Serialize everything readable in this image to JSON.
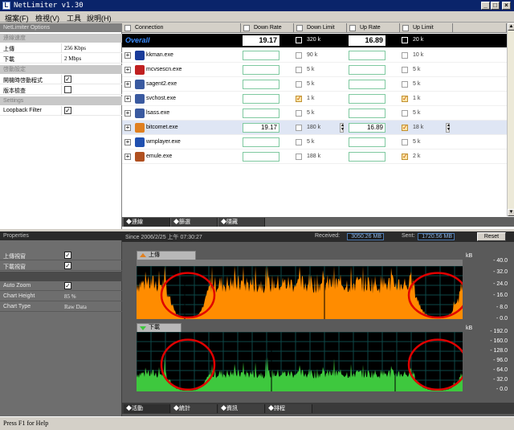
{
  "window": {
    "title": "NetLimiter v1.30",
    "controls": [
      "_",
      "□",
      "×"
    ]
  },
  "menu": [
    "檔案(F)",
    "檢視(V)",
    "工具",
    "說明(H)"
  ],
  "options": {
    "header": "NetLimiter Options",
    "sections": [
      {
        "title": "連線速度",
        "rows": [
          {
            "key": "上傳",
            "value": "256 Kbps"
          },
          {
            "key": "下載",
            "value": "2 Mbps"
          }
        ]
      },
      {
        "title": "啓動設定",
        "rows": [
          {
            "key": "開機時啓動程式",
            "checked": true
          },
          {
            "key": "版本檢查",
            "checked": false
          }
        ]
      },
      {
        "title": "Settings",
        "rows": [
          {
            "key": "Loopback Filter",
            "checked": true
          }
        ]
      }
    ]
  },
  "table": {
    "columns": [
      "Connection",
      "Down Rate",
      "Down Limit",
      "Up Rate",
      "Up Limit"
    ],
    "overall": {
      "name": "Overall",
      "down_rate": "19.17",
      "down_limit": "320 k",
      "up_rate": "16.89",
      "up_limit": "20 k"
    },
    "rows": [
      {
        "name": "kkman.exe",
        "down_rate": "",
        "down_limit": "90 k",
        "down_checked": false,
        "up_rate": "",
        "up_limit": "10 k",
        "up_checked": false,
        "icon": "kkman-icon",
        "color": "#1a3c9a"
      },
      {
        "name": "mcvsescn.exe",
        "down_rate": "",
        "down_limit": "5 k",
        "down_checked": false,
        "up_rate": "",
        "up_limit": "5 k",
        "up_checked": false,
        "icon": "mcafee-icon",
        "color": "#c02020"
      },
      {
        "name": "sagent2.exe",
        "down_rate": "",
        "down_limit": "5 k",
        "down_checked": false,
        "up_rate": "",
        "up_limit": "5 k",
        "up_checked": false,
        "icon": "window-icon",
        "color": "#3a5aa0"
      },
      {
        "name": "svchost.exe",
        "down_rate": "",
        "down_limit": "1 k",
        "down_checked": true,
        "up_rate": "",
        "up_limit": "1 k",
        "up_checked": true,
        "icon": "window-icon",
        "color": "#3a5aa0"
      },
      {
        "name": "lsass.exe",
        "down_rate": "",
        "down_limit": "5 k",
        "down_checked": false,
        "up_rate": "",
        "up_limit": "5 k",
        "up_checked": false,
        "icon": "window-icon",
        "color": "#3a5aa0"
      },
      {
        "name": "bitcomet.exe",
        "down_rate": "19.17",
        "down_limit": "180 k",
        "down_checked": false,
        "up_rate": "16.89",
        "up_limit": "18 k",
        "up_checked": true,
        "icon": "bitcomet-icon",
        "color": "#e08020",
        "selected": true
      },
      {
        "name": "wmplayer.exe",
        "down_rate": "",
        "down_limit": "5 k",
        "down_checked": false,
        "up_rate": "",
        "up_limit": "5 k",
        "up_checked": false,
        "icon": "wmplayer-icon",
        "color": "#2050b0"
      },
      {
        "name": "emule.exe",
        "down_rate": "",
        "down_limit": "188 k",
        "down_checked": false,
        "up_rate": "",
        "up_limit": "2 k",
        "up_checked": true,
        "icon": "emule-icon",
        "color": "#b05020"
      }
    ],
    "tabs": [
      "連線",
      "篩選",
      "隱藏"
    ]
  },
  "properties": {
    "header": "Properties",
    "rows": [
      {
        "key": "上傳視窗",
        "checked": true
      },
      {
        "key": "下載視窗",
        "checked": true
      },
      {
        "separator": true
      },
      {
        "key": "Auto Zoom",
        "checked": true
      },
      {
        "key": "Chart Height",
        "value": "85 %"
      },
      {
        "key": "Chart Type",
        "value": "Raw Data"
      }
    ]
  },
  "graph": {
    "since": "Since 2006/2/25 上午 07:30:27",
    "received_label": "Received:",
    "received": "3050.26 MB",
    "sent_label": "Sent:",
    "sent": "1720.56 MB",
    "reset": "Reset",
    "upload": {
      "label": "上傳",
      "unit": "kB",
      "ticks": [
        "40.0",
        "32.0",
        "24.0",
        "16.0",
        "8.0",
        "0.0"
      ],
      "color": "#ff8c00"
    },
    "download": {
      "label": "下載",
      "unit": "kB",
      "ticks": [
        "192.0",
        "160.0",
        "128.0",
        "96.0",
        "64.0",
        "32.0",
        "0.0"
      ],
      "color": "#3ec83e"
    },
    "tabs": [
      "活動",
      "統計",
      "資訊",
      "排程"
    ]
  },
  "status": "Press F1 for Help"
}
